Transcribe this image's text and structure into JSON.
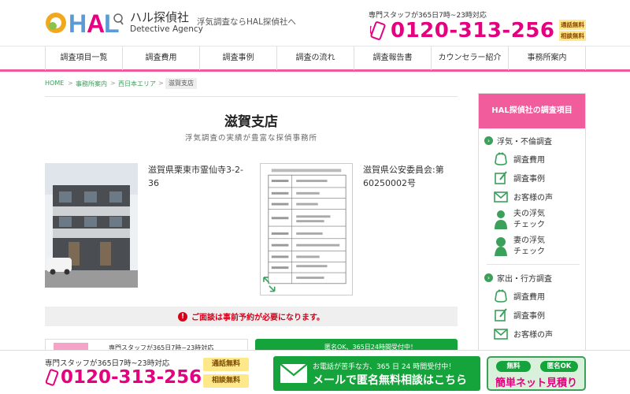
{
  "header": {
    "brand_jp": "ハル探偵社",
    "brand_en": "Detective Agency",
    "tagline": "浮気調査ならHAL探偵社へ",
    "hours": "専門スタッフが365日7時~23時対応",
    "phone": "0120-313-256",
    "badge_free": "通話無料",
    "badge_consult": "相談無料"
  },
  "nav": {
    "items": [
      "調査項目一覧",
      "調査費用",
      "調査事例",
      "調査の流れ",
      "調査報告書",
      "カウンセラー紹介",
      "事務所案内"
    ]
  },
  "breadcrumb": {
    "home": "HOME",
    "office": "事務所案内",
    "area": "西日本エリア",
    "current": "滋賀支店"
  },
  "main": {
    "title": "滋賀支店",
    "subtitle": "浮気調査の実績が豊富な探偵事務所",
    "address": "滋賀県栗東市霊仙寺3-2-36",
    "permit": "滋賀県公安委員会:第60250002号",
    "notice": "ご面談は事前予約が必要になります。",
    "peek_hours": "専門スタッフが365日7時~23時対応",
    "peek_mail": "匿名OK、365日24時間受付中！"
  },
  "sidebar": {
    "title": "HAL探偵社の調査項目",
    "section1": "浮気・不倫調査",
    "s1_items": [
      "調査費用",
      "調査事例",
      "お客様の声",
      "夫の浮気",
      "チェック",
      "妻の浮気",
      "チェック"
    ],
    "section2": "家出・行方調査",
    "s2_items": [
      "調査費用",
      "調査事例",
      "お客様の声"
    ]
  },
  "bottom": {
    "hours": "専門スタッフが365日7時~23時対応",
    "phone": "0120-313-256",
    "badge_free": "通話無料",
    "badge_consult": "相談無料",
    "mail_top": "お電話が苦手な方、365 日 24 時間受付中！",
    "mail_main": "メールで匿名無料相談はこちら",
    "net_free": "無料",
    "net_anon": "匿名OK",
    "net_main": "簡単ネット見積り"
  },
  "colors": {
    "pink": "#e4007f",
    "green": "#15a33b",
    "nav_line": "#ee5aa0",
    "sidebar_head": "#f05c9c"
  }
}
